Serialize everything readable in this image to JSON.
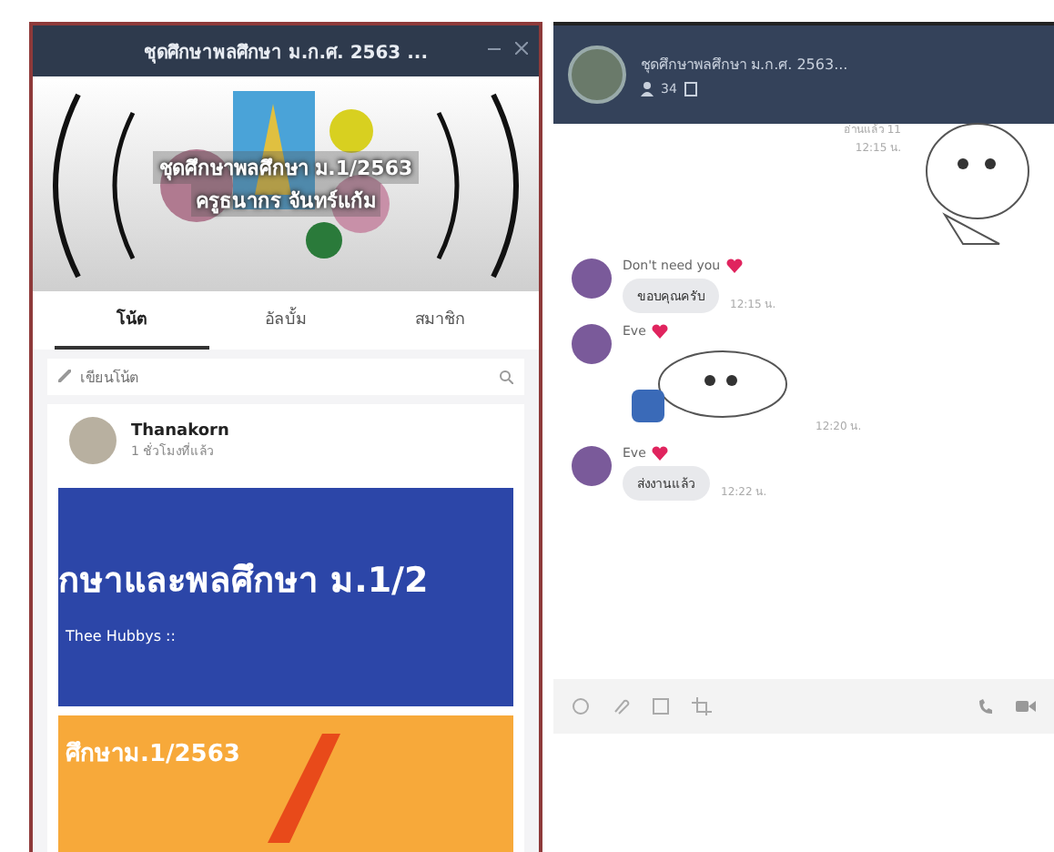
{
  "notes_window": {
    "title": "ชุดศึกษาพลศึกษา ม.ก.ศ. 2563 ...",
    "cover": {
      "title": "ชุดศึกษาพลศึกษา ม.1/2563",
      "subtitle": "ครูธนากร จันทร์แก้ม"
    },
    "tabs": [
      {
        "label": "โน้ต",
        "selected": true
      },
      {
        "label": "อัลบั้ม",
        "selected": false
      },
      {
        "label": "สมาชิก",
        "selected": false
      }
    ],
    "search": {
      "placeholder": "เขียนโน้ต"
    },
    "post": {
      "author": "Thanakorn",
      "subtitle": "1 ชั่วโมงที่แล้ว",
      "banner_title": "กษาและพลศึกษา ม.1/2",
      "banner_caption": "Thee Hubbys ::",
      "second_banner_title": "ศึกษาม.1/2563"
    }
  },
  "chat_window": {
    "title": "ชุดศึกษาพลศึกษา ม.ก.ศ. 2563...",
    "member_count": "34",
    "messages": [
      {
        "kind": "sticker",
        "read": "อ่านแล้ว 11",
        "time": "12:15 น."
      },
      {
        "kind": "text",
        "sender": "Don't need you",
        "text": "ขอบคุณครับ",
        "time": "12:15 น."
      },
      {
        "kind": "sticker",
        "sender": "Eve",
        "time": "12:20 น."
      },
      {
        "kind": "text",
        "sender": "Eve",
        "text": "ส่งงานแล้ว",
        "time": "12:22 น."
      }
    ]
  }
}
